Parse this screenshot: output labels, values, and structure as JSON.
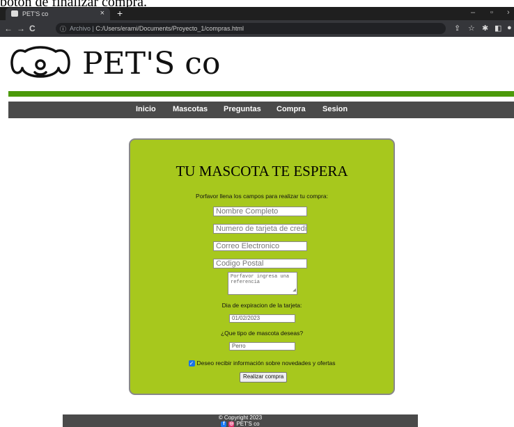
{
  "caption": "botón de finalizar compra.",
  "browser": {
    "tab_title": "PET'S co",
    "tab_close": "×",
    "new_tab": "+",
    "url_prefix": "Archivo",
    "url_path": "C:/Users/erami/Documents/Proyecto_1/compras.html"
  },
  "site": {
    "brand": "PET'S co",
    "menu": [
      "Inicio",
      "Mascotas",
      "Preguntas",
      "Compra",
      "Sesion"
    ]
  },
  "form": {
    "title": "TU MASCOTA TE ESPERA",
    "subtitle": "Porfavor llena los campos para realizar tu compra:",
    "name_placeholder": "Nombre Completo",
    "card_placeholder": "Numero de tarjeta de credito",
    "email_placeholder": "Correo Electronico",
    "zip_placeholder": "Codigo Postal",
    "reference_placeholder": "Porfavor ingresa una referencia",
    "expiry_label": "Dia de expiracion de la tarjeta:",
    "expiry_value": "01/02/2023",
    "pet_type_label": "¿Que tipo de mascota deseas?",
    "pet_type_value": "Perro",
    "newsletter_label": "Deseo recibir información sobre novedades y ofertas",
    "newsletter_checked": true,
    "submit_label": "Realizar compra"
  },
  "footer": {
    "copyright": "© Copyright 2023",
    "brand": "PET'S co"
  },
  "colors": {
    "card_bg": "#a7c81d",
    "accent_line": "#4c9a0a",
    "menu_bg": "#4a4a4a"
  }
}
